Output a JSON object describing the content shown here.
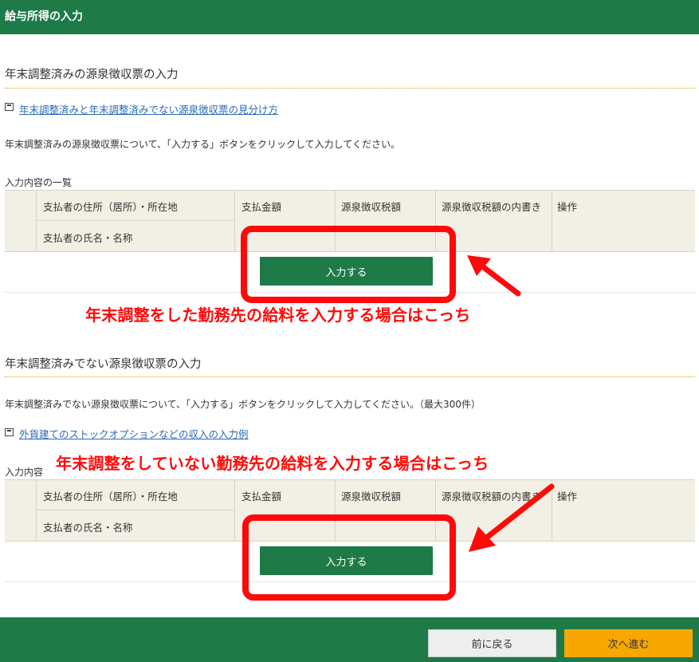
{
  "header": {
    "title": "給与所得の入力"
  },
  "section1": {
    "title": "年末調整済みの源泉徴収票の入力",
    "link": "年末調整済みと年末調整済みでない源泉徴収票の見分け方",
    "description": "年末調整済みの源泉徴収票について、「入力する」ボタンをクリックして入力してください。",
    "list_label": "入力内容の一覧",
    "table_headers": {
      "address": "支払者の住所（居所）・所在地",
      "name": "支払者の氏名・名称",
      "amount": "支払金額",
      "tax": "源泉徴収税額",
      "breakdown": "源泉徴収税額の内書き",
      "action": "操作"
    },
    "input_button": "入力する",
    "annotation": "年末調整をした勤務先の給料を入力する場合はこっち"
  },
  "section2": {
    "title": "年末調整済みでない源泉徴収票の入力",
    "description": "年末調整済みでない源泉徴収票について、「入力する」ボタンをクリックして入力してください。（最大300件）",
    "link": "外貨建てのストックオプションなどの収入の入力例",
    "list_label": "入力内容",
    "table_headers": {
      "address": "支払者の住所（居所）・所在地",
      "name": "支払者の氏名・名称",
      "amount": "支払金額",
      "tax": "源泉徴収税額",
      "breakdown": "源泉徴収税額の内書き",
      "action": "操作"
    },
    "input_button": "入力する",
    "annotation": "年末調整をしていない勤務先の給料を入力する場合はこっち"
  },
  "footer": {
    "back_button": "前に戻る",
    "next_button": "次へ進む"
  },
  "colors": {
    "brand_green": "#1e7a47",
    "accent_orange": "#f6a800",
    "annotation_red": "#ff0a0a",
    "link_blue": "#2a6ab8"
  }
}
